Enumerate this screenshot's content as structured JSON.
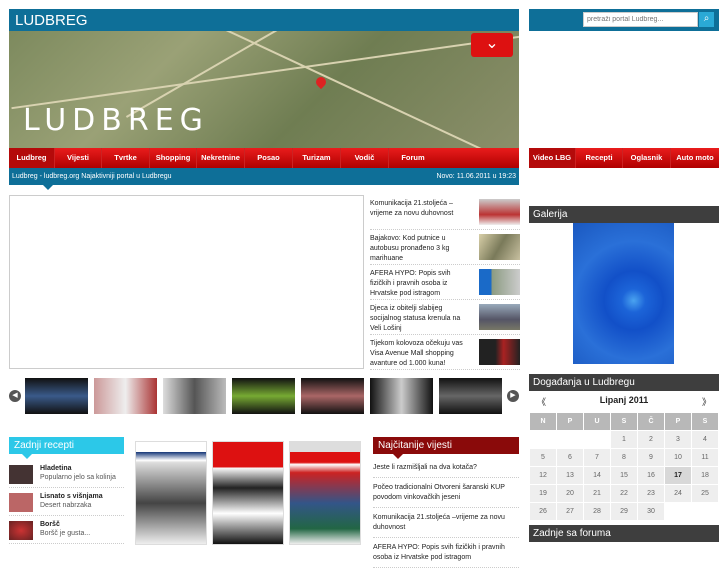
{
  "header": {
    "title": "LUDBREG",
    "map_logo": "LUDBREG"
  },
  "nav_main": [
    "Ludbreg",
    "Vijesti",
    "Tvrtke",
    "Shopping",
    "Nekretnine",
    "Posao",
    "Turizam",
    "Vodič",
    "Forum"
  ],
  "nav_side": [
    "Video LBG",
    "Recepti",
    "Oglasnik",
    "Auto moto"
  ],
  "info": {
    "left": "Ludbreg - ludbreg.org Najaktivniji portal u Ludbregu",
    "right": "Novo: 11.06.2011  u  19:23"
  },
  "search": {
    "placeholder": "pretraži portal Ludbreg..."
  },
  "news": [
    "Komunikacija 21.stoljeća –vrijeme za novu duhovnost",
    "Bajakovo: Kod putnice u autobusu pronađeno 3 kg marihuane",
    "AFERA HYPO:  Popis svih fizičkih i pravnih osoba iz Hrvatske pod istragom",
    "Djeca iz obitelji slabijeg socijalnog statusa krenula na Veli Lošinj",
    "Tijekom kolovoza očekuju vas Visa Avenue Mall shopping avanture od 1.000 kuna!"
  ],
  "recipes": {
    "title": "Zadnji recepti",
    "items": [
      {
        "name": "Hladetina",
        "desc": "Popularno jelo sa kolinja"
      },
      {
        "name": "Lisnato s višnjama",
        "desc": "Desert nabrzaka"
      },
      {
        "name": "Boršč",
        "desc": "Boršč je gusta..."
      }
    ]
  },
  "top_news": {
    "title": "Najčitanije vijesti",
    "items": [
      "Jeste li razmišljali na dva kotača?",
      "Počeo tradicionalni Otvoreni šaranski KUP povodom vinkovačkih jeseni",
      "Komunikacija 21.stoljeća –vrijeme za novu duhovnost",
      "AFERA HYPO: Popis svih fizičkih i pravnih osoba iz Hrvatske pod istragom"
    ]
  },
  "gallery": {
    "title": "Galerija"
  },
  "calendar": {
    "title": "Događanja u Ludbregu",
    "month": "Lipanj 2011",
    "prev": "《",
    "next": "》",
    "days": [
      "N",
      "P",
      "U",
      "S",
      "Č",
      "P",
      "S"
    ],
    "weeks": [
      [
        "",
        "",
        "",
        "1",
        "2",
        "3",
        "4"
      ],
      [
        "5",
        "6",
        "7",
        "8",
        "9",
        "10",
        "11"
      ],
      [
        "12",
        "13",
        "14",
        "15",
        "16",
        "17",
        "18"
      ],
      [
        "19",
        "20",
        "21",
        "22",
        "23",
        "24",
        "25"
      ],
      [
        "26",
        "27",
        "28",
        "29",
        "30",
        "",
        ""
      ]
    ],
    "today": "17"
  },
  "forum": {
    "title": "Zadnje sa foruma"
  }
}
